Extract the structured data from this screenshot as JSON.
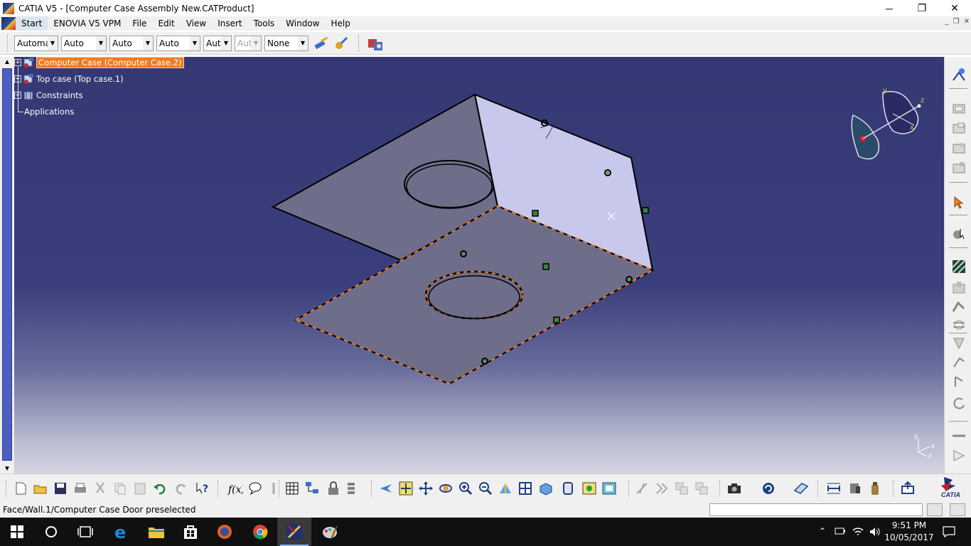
{
  "window": {
    "title": "CATIA V5 - [Computer Case Assembly New.CATProduct]",
    "minimize": "─",
    "restore": "❐",
    "close": "✕"
  },
  "menu": {
    "items": [
      "Start",
      "ENOVIA V5 VPM",
      "File",
      "Edit",
      "View",
      "Insert",
      "Tools",
      "Window",
      "Help"
    ],
    "mdi_minimize": "_",
    "mdi_restore": "❐",
    "mdi_close": "✕"
  },
  "toolbar": {
    "combos": [
      {
        "value": "Automa",
        "disabled": false
      },
      {
        "value": "Auto",
        "disabled": false
      },
      {
        "value": "Auto",
        "disabled": false
      },
      {
        "value": "Auto",
        "disabled": false
      },
      {
        "value": "Aut",
        "disabled": false
      },
      {
        "value": "Aut",
        "disabled": true
      },
      {
        "value": "None",
        "disabled": false
      }
    ],
    "icons": [
      "painter-icon",
      "material-brush-icon",
      "apply-material-icon"
    ]
  },
  "tree": {
    "items": [
      {
        "label": "Computer Case (Computer Case.2)",
        "selected": true,
        "icon": "part-icon"
      },
      {
        "label": "Top case (Top case.1)",
        "selected": false,
        "icon": "part-icon"
      },
      {
        "label": "Constraints",
        "selected": false,
        "icon": "constraints-icon"
      },
      {
        "label": "Applications",
        "selected": false,
        "icon": ""
      }
    ]
  },
  "compass": {
    "x_label": "x",
    "y_label": "y",
    "z_label": "z"
  },
  "axis": {
    "x_label": "x",
    "y_label": "y",
    "z_label": "z"
  },
  "right_toolbar": {
    "icons": [
      "assembly-workbench-icon",
      "product-structure-icon",
      "new-component-icon",
      "new-product-icon",
      "new-part-icon",
      "select-icon",
      "snap-icon",
      "constraint-icon",
      "fix-icon",
      "contact-icon",
      "offset-icon",
      "angle-icon",
      "manipulation-icon",
      "reuse-pattern-icon",
      "update-icon",
      "measure-icon",
      "analysis-icon"
    ]
  },
  "bottom_toolbar": {
    "icons": [
      "new-icon",
      "open-icon",
      "save-icon",
      "print-icon",
      "cut-icon",
      "copy-icon",
      "paste-icon",
      "undo-icon",
      "redo-icon",
      "whats-this-icon",
      "formula-icon",
      "comment-icon",
      "link-icon",
      "catalog-icon",
      "tree-expand-icon",
      "lock-icon",
      "reorder-icon",
      "fly-mode-icon",
      "fit-all-icon",
      "pan-icon",
      "rotate-icon",
      "zoom-in-icon",
      "zoom-out-icon",
      "normal-view-icon",
      "multi-view-icon",
      "iso-view-icon",
      "view-mode-icon",
      "hide-show-icon",
      "swap-visible-icon",
      "manipulation-mode-icon",
      "explode-icon",
      "clash-icon",
      "section-icon",
      "camera-icon",
      "refresh-icon",
      "plane-icon",
      "distance-icon",
      "bill-of-materials-icon",
      "weight-icon",
      "publish-icon",
      "catia-logo-icon"
    ],
    "catia_label": "CATIA"
  },
  "status": {
    "message": "Face/Wall.1/Computer Case Door preselected",
    "command_value": ""
  },
  "taskbar": {
    "time": "9:51 PM",
    "date": "10/05/2017",
    "apps": [
      "start-icon",
      "cortana-icon",
      "task-view-icon",
      "edge-icon",
      "file-explorer-icon",
      "store-icon",
      "firefox-icon",
      "chrome-icon",
      "catia-icon",
      "paint-icon"
    ]
  },
  "colors": {
    "viewport_top": "#343873",
    "selection_orange": "#f07a22",
    "part_fill": "#6e6e8a",
    "wall_fill": "#c8c8ec"
  }
}
